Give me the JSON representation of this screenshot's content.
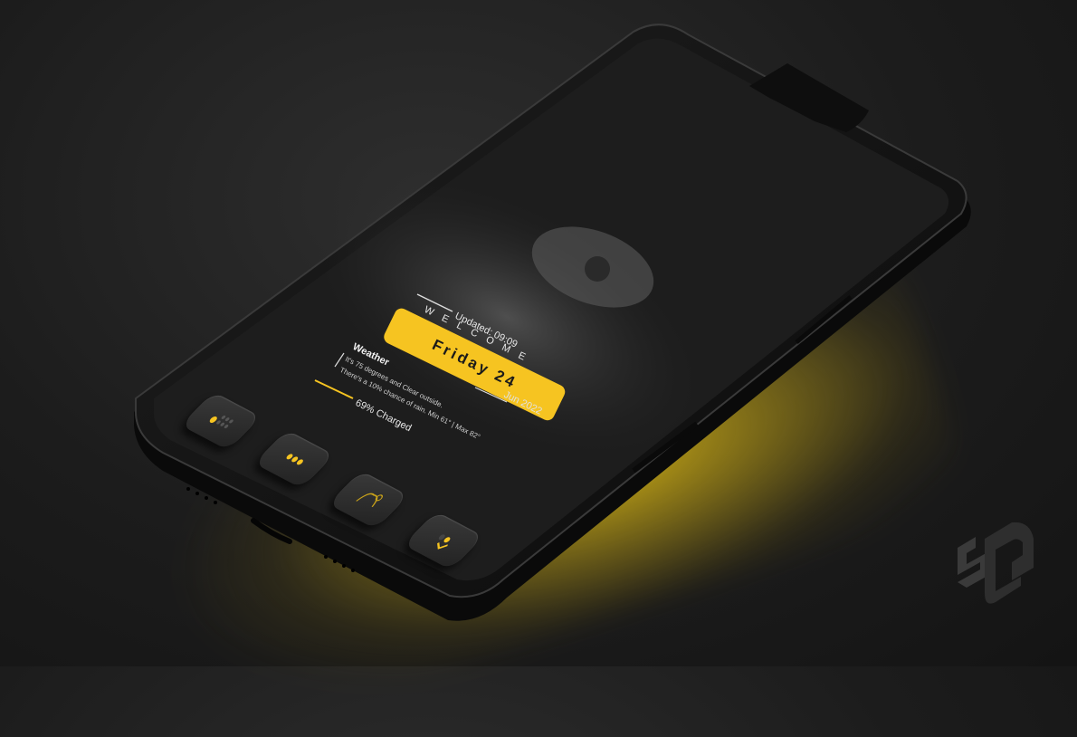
{
  "widget": {
    "welcome": "WELCOME",
    "updated": "Updated: 09:09",
    "day": "Friday 24",
    "month_year": "Jun 2022",
    "weather_title": "Weather",
    "weather_line1": "It's 75 degrees and Clear outside.",
    "weather_line2": "There's a 10% chance of rain. Min 61° | Max 82°",
    "battery": "69% Charged"
  },
  "dock": {
    "icons": [
      "keypad-icon",
      "messages-icon",
      "photos-icon",
      "camera-icon"
    ]
  },
  "colors": {
    "accent": "#f6c421",
    "background": "#1c1c1c",
    "phone_body": "#111111"
  }
}
